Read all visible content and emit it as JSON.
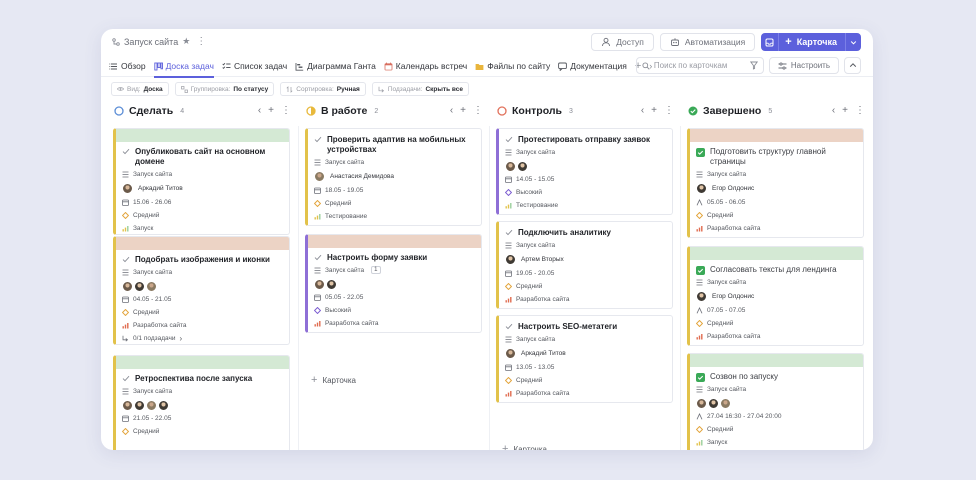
{
  "header": {
    "project_name": "Запуск сайта",
    "access_label": "Доступ",
    "automation_label": "Автоматизация",
    "new_card_label": "Карточка"
  },
  "tabs": [
    {
      "label": "Обзор"
    },
    {
      "label": "Доска задач"
    },
    {
      "label": "Список задач"
    },
    {
      "label": "Диаграмма Ганта"
    },
    {
      "label": "Календарь встреч"
    },
    {
      "label": "Файлы по сайту"
    },
    {
      "label": "Документация"
    }
  ],
  "search": {
    "placeholder": "Поиск по карточкам"
  },
  "configure_label": "Настроить",
  "chips": [
    {
      "key": "Вид:",
      "value": "Доска"
    },
    {
      "key": "Группировка:",
      "value": "По статусу"
    },
    {
      "key": "Сортировка:",
      "value": "Ручная"
    },
    {
      "key": "Подзадачи:",
      "value": "Скрыть все"
    }
  ],
  "add_card_label": "Карточка",
  "colors": {
    "accent": "#5c60dc",
    "todo": "#5b8dd6",
    "in_progress": "#e8b93c",
    "review": "#e1705a",
    "done": "#3aa957",
    "band_green": "#d4e9d4",
    "band_peach": "#ecd3c5",
    "bar_yellow": "#e2c24a",
    "bar_purple": "#8e6fd6",
    "bar_green": "#7cc28a"
  },
  "columns": [
    {
      "title": "Сделать",
      "count": "4",
      "cards": [
        {
          "title": "Опубликовать сайт на основном домене",
          "project": "Запуск сайта",
          "assignee": "Аркадий Титов",
          "dates": "15.06 - 26.06",
          "priority": "Средний",
          "tag": "Запуск"
        },
        {
          "title": "Подобрать изображения и иконки",
          "project": "Запуск сайта",
          "dates": "04.05 - 21.05",
          "priority": "Средний",
          "tag": "Разработка сайта",
          "subtasks": "0/1 подзадачи"
        },
        {
          "title": "Ретроспектива после запуска",
          "project": "Запуск сайта",
          "dates": "21.05 - 22.05",
          "priority": "Средний"
        }
      ]
    },
    {
      "title": "В работе",
      "count": "2",
      "cards": [
        {
          "title": "Проверить адаптив на мобильных устройствах",
          "project": "Запуск сайта",
          "assignee": "Анастасия Демидова",
          "dates": "18.05 - 19.05",
          "priority": "Средний",
          "tag": "Тестирование"
        },
        {
          "title": "Настроить форму заявки",
          "project": "Запуск сайта",
          "project_count": "1",
          "dates": "05.05 - 22.05",
          "priority": "Высокий",
          "tag": "Разработка сайта"
        }
      ]
    },
    {
      "title": "Контроль",
      "count": "3",
      "cards": [
        {
          "title": "Протестировать отправку заявок",
          "project": "Запуск сайта",
          "dates": "14.05 - 15.05",
          "priority": "Высокий",
          "tag": "Тестирование"
        },
        {
          "title": "Подключить аналитику",
          "project": "Запуск сайта",
          "assignee": "Артем Вторых",
          "dates": "19.05 - 20.05",
          "priority": "Средний",
          "tag": "Разработка сайта"
        },
        {
          "title": "Настроить SEO-метатеги",
          "project": "Запуск сайта",
          "assignee": "Аркадий Титов",
          "dates": "13.05 - 13.05",
          "priority": "Средний",
          "tag": "Разработка сайта"
        }
      ]
    },
    {
      "title": "Завершено",
      "count": "5",
      "cards": [
        {
          "title": "Подготовить структуру главной страницы",
          "project": "Запуск сайта",
          "assignee": "Егор Олдонис",
          "dates": "05.05 - 06.05",
          "priority": "Средний",
          "tag": "Разработка сайта"
        },
        {
          "title": "Согласовать тексты для лендинга",
          "project": "Запуск сайта",
          "assignee": "Егор Олдонис",
          "dates": "07.05 - 07.05",
          "priority": "Средний",
          "tag": "Разработка сайта"
        },
        {
          "title": "Созвон по запуску",
          "project": "Запуск сайта",
          "dates": "27.04 16:30 - 27.04 20:00",
          "priority": "Средний",
          "tag": "Запуск"
        }
      ]
    }
  ]
}
